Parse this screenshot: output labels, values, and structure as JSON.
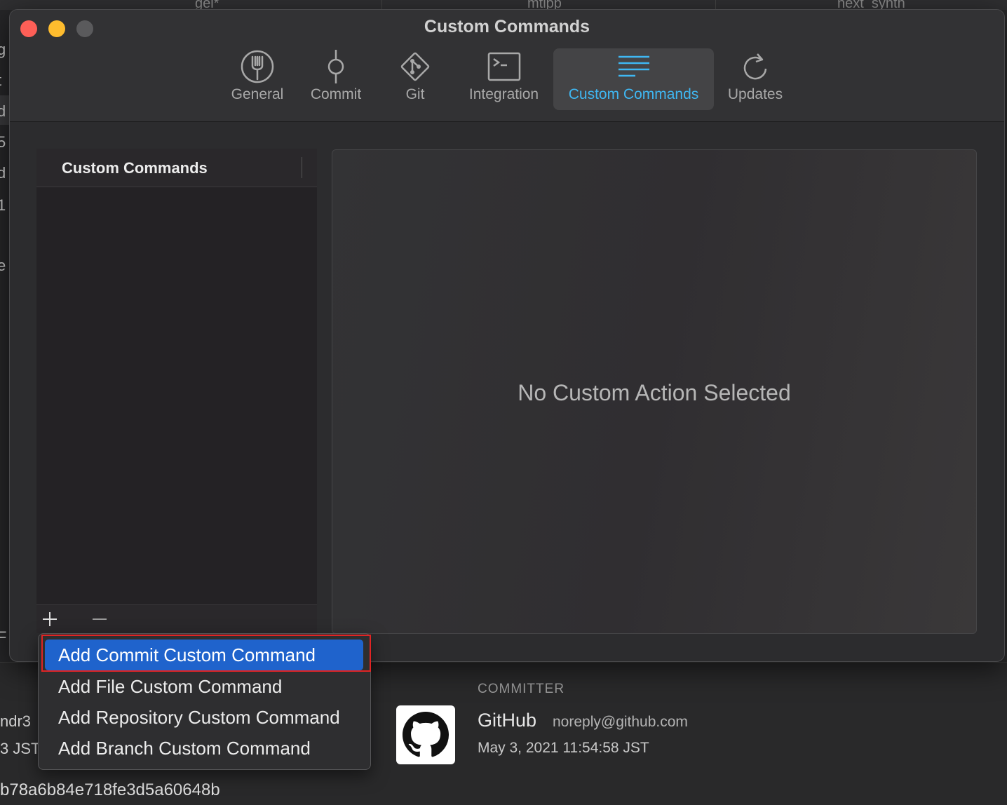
{
  "background": {
    "tabs": [
      "gel*",
      "mtlpp",
      "next_synth"
    ],
    "left_fragments": [
      "g",
      "t",
      "d",
      "5",
      "d",
      "1",
      "e",
      "F"
    ],
    "bottom_left_fragments": [
      "ndr3",
      "3 JST"
    ],
    "committer": {
      "heading": "COMMITTER",
      "name": "GitHub",
      "email": "noreply@github.com",
      "date": "May 3, 2021 11:54:58 JST",
      "avatar_icon": "github-logo-icon"
    },
    "commit_hash": "b78a6b84e718fe3d5a60648b"
  },
  "window": {
    "title": "Custom Commands",
    "toolbar": [
      {
        "label": "General",
        "icon": "fork-icon"
      },
      {
        "label": "Commit",
        "icon": "commit-icon"
      },
      {
        "label": "Git",
        "icon": "git-icon"
      },
      {
        "label": "Integration",
        "icon": "terminal-icon"
      },
      {
        "label": "Custom Commands",
        "icon": "lines-icon",
        "selected": true
      },
      {
        "label": "Updates",
        "icon": "refresh-icon"
      }
    ],
    "list": {
      "header": "Custom Commands",
      "add_button": "+",
      "remove_button": "—"
    },
    "detail": {
      "empty_state": "No Custom Action Selected"
    }
  },
  "menu": {
    "items": [
      {
        "label": "Add Commit Custom Command",
        "active": true
      },
      {
        "label": "Add File Custom Command"
      },
      {
        "label": "Add Repository Custom Command"
      },
      {
        "label": "Add Branch Custom Command"
      }
    ]
  },
  "colors": {
    "accent": "#3fb7f2",
    "menu_selection": "#1f63cc",
    "highlight_box": "#e02424",
    "close": "#fe5f57",
    "minimize": "#febc2e"
  }
}
